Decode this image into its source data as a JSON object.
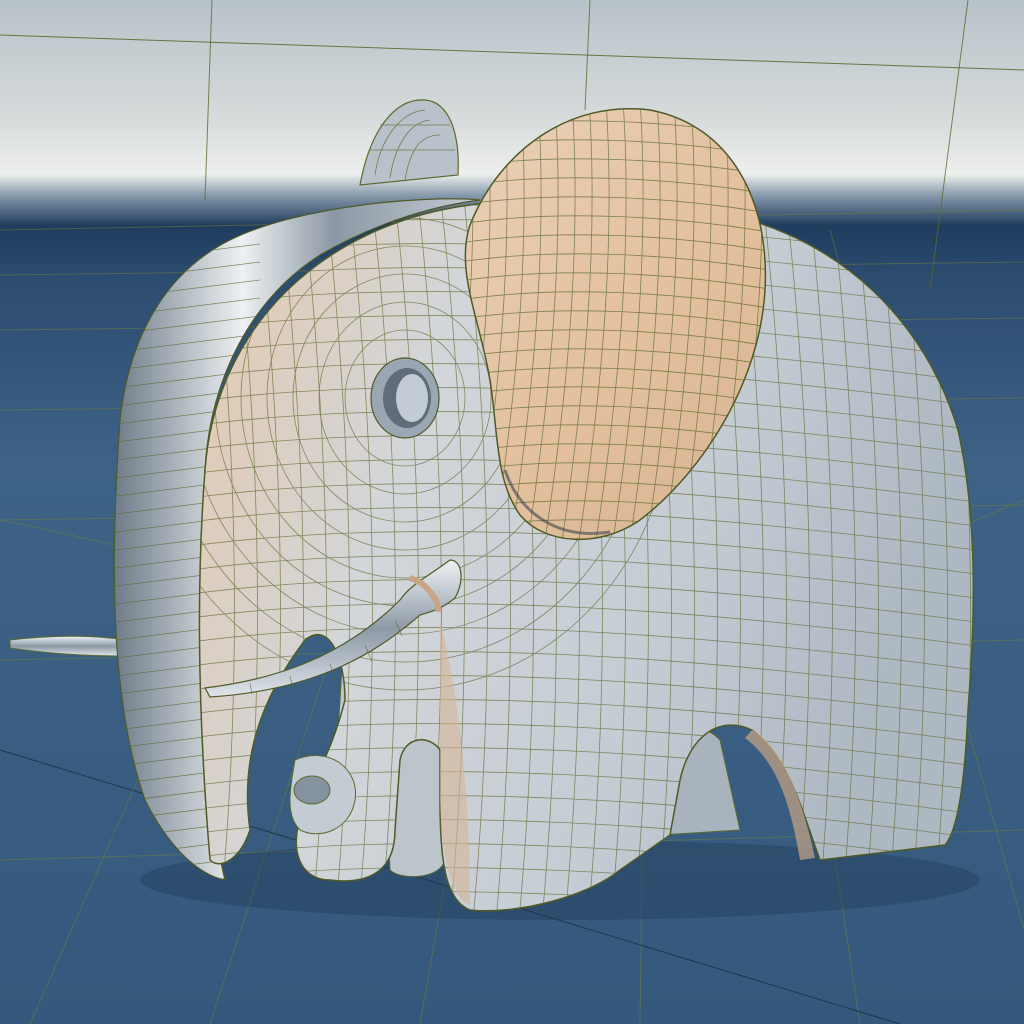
{
  "scene": {
    "subject": "elephant-toy-model",
    "render_mode": "wireframe-on-shaded",
    "colors": {
      "sky_top": "#c9d3d8",
      "sky_band": "#e9ecec",
      "horizon_dark": "#1f3c5e",
      "floor": "#3d6286",
      "grid_line": "#6a7a3a",
      "body_silver": "#c8cfd6",
      "body_shadow": "#7d8a98",
      "ear_peach": "#e6c4a4",
      "wire": "#5d6a2e",
      "tusk_chrome": "#b8c2cc"
    }
  }
}
